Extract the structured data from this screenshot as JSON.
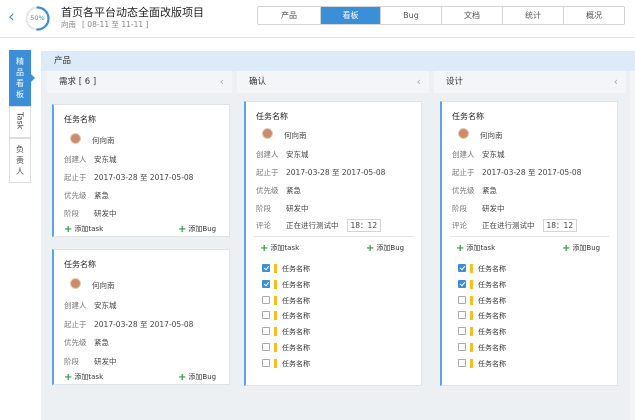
{
  "header": {
    "progress": "50%",
    "progress_value": 0.5,
    "title": "首页各平台动态全面改版项目",
    "owner": "向南",
    "date_range": "[ 08-11 至 11-11 ]",
    "tabs": [
      "产品",
      "看板",
      "Bug",
      "文档",
      "统计",
      "概况"
    ],
    "active_tab": "看板"
  },
  "sidenav": [
    {
      "label": "精品看板",
      "active": true
    },
    {
      "label": "Task",
      "active": false
    },
    {
      "label": "负责人",
      "active": false
    }
  ],
  "board": {
    "title": "产品",
    "columns": [
      {
        "title": "需求 [ 6 ]"
      },
      {
        "title": "确认"
      },
      {
        "title": "设计"
      }
    ]
  },
  "labels": {
    "task_name": "任务名称",
    "creator_key": "创建人",
    "period_key": "起止于",
    "priority_key": "优先级",
    "stage_key": "阶段",
    "comment_key": "评论",
    "add_task": "添加task",
    "add_bug": "添加Bug"
  },
  "card_values": {
    "assignee": "何向南",
    "creator": "安东城",
    "period": "2017-03-28 至 2017-05-08",
    "priority": "紧急",
    "stage": "研发中",
    "comment": "正在进行测试中",
    "comment_time": "18：12"
  },
  "task_lists": {
    "confirm": [
      true,
      true,
      false,
      false,
      false,
      false,
      false
    ],
    "design": [
      true,
      true,
      false,
      false,
      false,
      false,
      false
    ]
  },
  "colors": {
    "accent": "#3b8fd9",
    "add_green": "#2e9b3c",
    "task_marker": "#f2c21b",
    "board_bg": "#edf0f3"
  }
}
